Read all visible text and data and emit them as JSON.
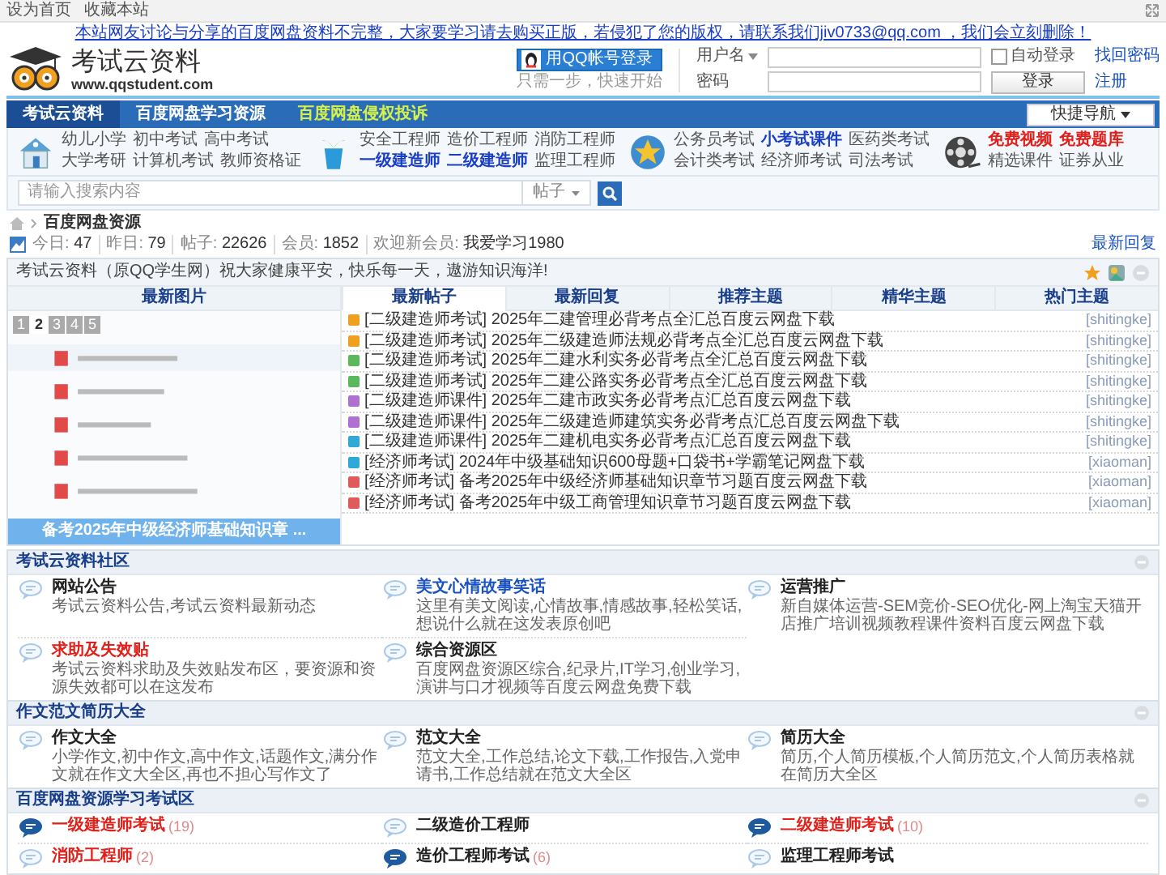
{
  "top_bar": {
    "links": [
      "设为首页",
      "收藏本站"
    ]
  },
  "notice": "本站网友讨论与分享的百度网盘资料不完整，大家要学习请去购买正版，若侵犯了您的版权，请联系我们jiv0733@qq.com ，我们会立刻删除！",
  "header": {
    "logo_title": "考试云资料",
    "logo_url": "www.qqstudent.com",
    "qq_login": "用QQ帐号登录",
    "qq_hint": "只需一步，快速开始",
    "login": {
      "username_label": "用户名",
      "password_label": "密码",
      "remember_label": "自动登录",
      "remember_checked": false,
      "forgot": "找回密码",
      "submit": "登录",
      "register": "注册"
    }
  },
  "nav": {
    "items": [
      {
        "label": "考试云资料",
        "selected": true,
        "kind": "normal"
      },
      {
        "label": "百度网盘学习资源",
        "selected": false,
        "kind": "normal"
      },
      {
        "label": "百度网盘侵权投诉",
        "selected": false,
        "kind": "highlight"
      }
    ],
    "quick_nav": "快捷导航"
  },
  "quick_links": [
    {
      "kind": "house",
      "rows": [
        [
          {
            "label": "幼儿小学",
            "color": "#555555"
          },
          {
            "label": "初中考试",
            "color": "#555555"
          },
          {
            "label": "高中考试",
            "color": "#555555"
          }
        ],
        [
          {
            "label": "大学考研",
            "color": "#555555"
          },
          {
            "label": "计算机考试",
            "color": "#555555"
          },
          {
            "label": "教师资格证",
            "color": "#555555"
          }
        ]
      ]
    },
    {
      "kind": "plant",
      "rows": [
        [
          {
            "label": "安全工程师",
            "color": "#555555"
          },
          {
            "label": "造价工程师",
            "color": "#555555"
          },
          {
            "label": "消防工程师",
            "color": "#555555"
          }
        ],
        [
          {
            "label": "一级建造师",
            "color": "#1a3fc4"
          },
          {
            "label": "二级建造师",
            "color": "#1a3fc4"
          },
          {
            "label": "监理工程师",
            "color": "#555555"
          }
        ]
      ]
    },
    {
      "kind": "star",
      "rows": [
        [
          {
            "label": "公务员考试",
            "color": "#555555"
          },
          {
            "label": "小考试课件",
            "color": "#1a3fc4"
          },
          {
            "label": "医药类考试",
            "color": "#555555"
          }
        ],
        [
          {
            "label": "会计类考试",
            "color": "#555555"
          },
          {
            "label": "经济师考试",
            "color": "#555555"
          },
          {
            "label": "司法考试",
            "color": "#555555"
          }
        ]
      ]
    },
    {
      "kind": "film",
      "rows": [
        [
          {
            "label": "免费视频",
            "color": "#e0201a"
          },
          {
            "label": "免费题库",
            "color": "#e0201a"
          }
        ],
        [
          {
            "label": "精选课件",
            "color": "#555555"
          },
          {
            "label": "证券从业",
            "color": "#555555"
          }
        ]
      ]
    }
  ],
  "search": {
    "placeholder": "请输入搜索内容",
    "scope": "帖子"
  },
  "breadcrumb": [
    "百度网盘资源"
  ],
  "stats": [
    {
      "label": "今日:",
      "value": "47"
    },
    {
      "label": "昨日:",
      "value": "79"
    },
    {
      "label": "帖子:",
      "value": "22626"
    },
    {
      "label": "会员:",
      "value": "1852"
    },
    {
      "label": "欢迎新会员:",
      "value": "我爱学习1980"
    }
  ],
  "latest_reply": "最新回复",
  "bulletin": {
    "title": "考试云资料（原QQ学生网）祝大家健康平安，快乐每一天，遨游知识海洋!",
    "image_tab": "最新图片",
    "pages": [
      {
        "label": "1",
        "selected": false
      },
      {
        "label": "2",
        "selected": true
      },
      {
        "label": "3",
        "selected": false
      },
      {
        "label": "4",
        "selected": false
      },
      {
        "label": "5",
        "selected": false
      }
    ],
    "caption": "备考2025年中级经济师基础知识章 ...",
    "tabs": [
      {
        "label": "最新帖子",
        "selected": true
      },
      {
        "label": "最新回复",
        "selected": false
      },
      {
        "label": "推荐主题",
        "selected": false
      },
      {
        "label": "精华主题",
        "selected": false
      },
      {
        "label": "热门主题",
        "selected": false
      }
    ],
    "threads": [
      {
        "color": "#f0a020",
        "title": "[二级建造师考试] 2025年二建管理必背考点全汇总百度云网盘下载",
        "author": "[shitingke]"
      },
      {
        "color": "#f0a020",
        "title": "[二级建造师考试] 2025年二级建造师法规必背考点全汇总百度云网盘下载",
        "author": "[shitingke]"
      },
      {
        "color": "#5cb85c",
        "title": "[二级建造师考试] 2025年二建水利实务必背考点全汇总百度云网盘下载",
        "author": "[shitingke]"
      },
      {
        "color": "#5cb85c",
        "title": "[二级建造师考试] 2025年二建公路实务必背考点全汇总百度云网盘下载",
        "author": "[shitingke]"
      },
      {
        "color": "#b070d0",
        "title": "[二级建造师课件] 2025年二建市政实务必背考点汇总百度云网盘下载",
        "author": "[shitingke]"
      },
      {
        "color": "#b070d0",
        "title": "[二级建造师课件] 2025年二级建造师建筑实务必背考点汇总百度云网盘下载",
        "author": "[shitingke]"
      },
      {
        "color": "#30a8d8",
        "title": "[二级建造师课件] 2025年二建机电实务必背考点汇总百度云网盘下载",
        "author": "[shitingke]"
      },
      {
        "color": "#30a8d8",
        "title": "[经济师考试] 2024年中级基础知识600母题+口袋书+学霸笔记网盘下载",
        "author": "[xiaoman]"
      },
      {
        "color": "#e05a5a",
        "title": "[经济师考试] 备考2025年中级经济师基础知识章节习题百度云网盘下载",
        "author": "[xiaoman]"
      },
      {
        "color": "#e05a5a",
        "title": "[经济师考试] 备考2025年中级工商管理知识章节习题百度云网盘下载",
        "author": "[xiaoman]"
      }
    ]
  },
  "sections": [
    {
      "title": "考试云资料社区",
      "kind": "detailed",
      "forums": [
        {
          "name": "网站公告",
          "color": "#222222",
          "new": false,
          "description": "考试云资料公告,考试云资料最新动态"
        },
        {
          "name": "美文心情故事笑话",
          "color": "#1a52c4",
          "new": false,
          "description": "这里有美文阅读,心情故事,情感故事,轻松笑话,想说什么就在这发表原创吧"
        },
        {
          "name": "运营推广",
          "color": "#222222",
          "new": false,
          "description": "新自媒体运营-SEM竞价-SEO优化-网上淘宝天猫开店推广培训视频教程课件资料百度云网盘下载"
        },
        {
          "name": "求助及失效贴",
          "color": "#e0201a",
          "new": false,
          "description": "考试云资料求助及失效贴发布区，要资源和资源失效都可以在这发布"
        },
        {
          "name": "综合资源区",
          "color": "#222222",
          "new": false,
          "description": "百度网盘资源区综合,纪录片,IT学习,创业学习,演讲与口才视频等百度云网盘免费下载"
        }
      ]
    },
    {
      "title": "作文范文简历大全",
      "kind": "detailed",
      "forums": [
        {
          "name": "作文大全",
          "color": "#222222",
          "new": false,
          "description": "小学作文,初中作文,高中作文,话题作文,满分作文就在作文大全区,再也不担心写作文了"
        },
        {
          "name": "范文大全",
          "color": "#222222",
          "new": false,
          "description": "范文大全,工作总结,论文下载,工作报告,入党申请书,工作总结就在范文大全区"
        },
        {
          "name": "简历大全",
          "color": "#222222",
          "new": false,
          "description": "简历,个人简历模板,个人简历范文,个人简历表格就在简历大全区"
        }
      ]
    },
    {
      "title": "百度网盘资源学习考试区",
      "kind": "compact",
      "forums": [
        {
          "name": "一级建造师考试",
          "color": "#e0201a",
          "new": true,
          "count": "(19)"
        },
        {
          "name": "二级造价工程师",
          "color": "#222222",
          "new": false
        },
        {
          "name": "二级建造师考试",
          "color": "#e0201a",
          "new": true,
          "count": "(10)"
        },
        {
          "name": "消防工程师",
          "color": "#e0201a",
          "new": false,
          "count": "(2)"
        },
        {
          "name": "造价工程师考试",
          "color": "#222222",
          "new": true,
          "count": "(6)"
        },
        {
          "name": "监理工程师考试",
          "color": "#222222",
          "new": false
        }
      ]
    }
  ]
}
